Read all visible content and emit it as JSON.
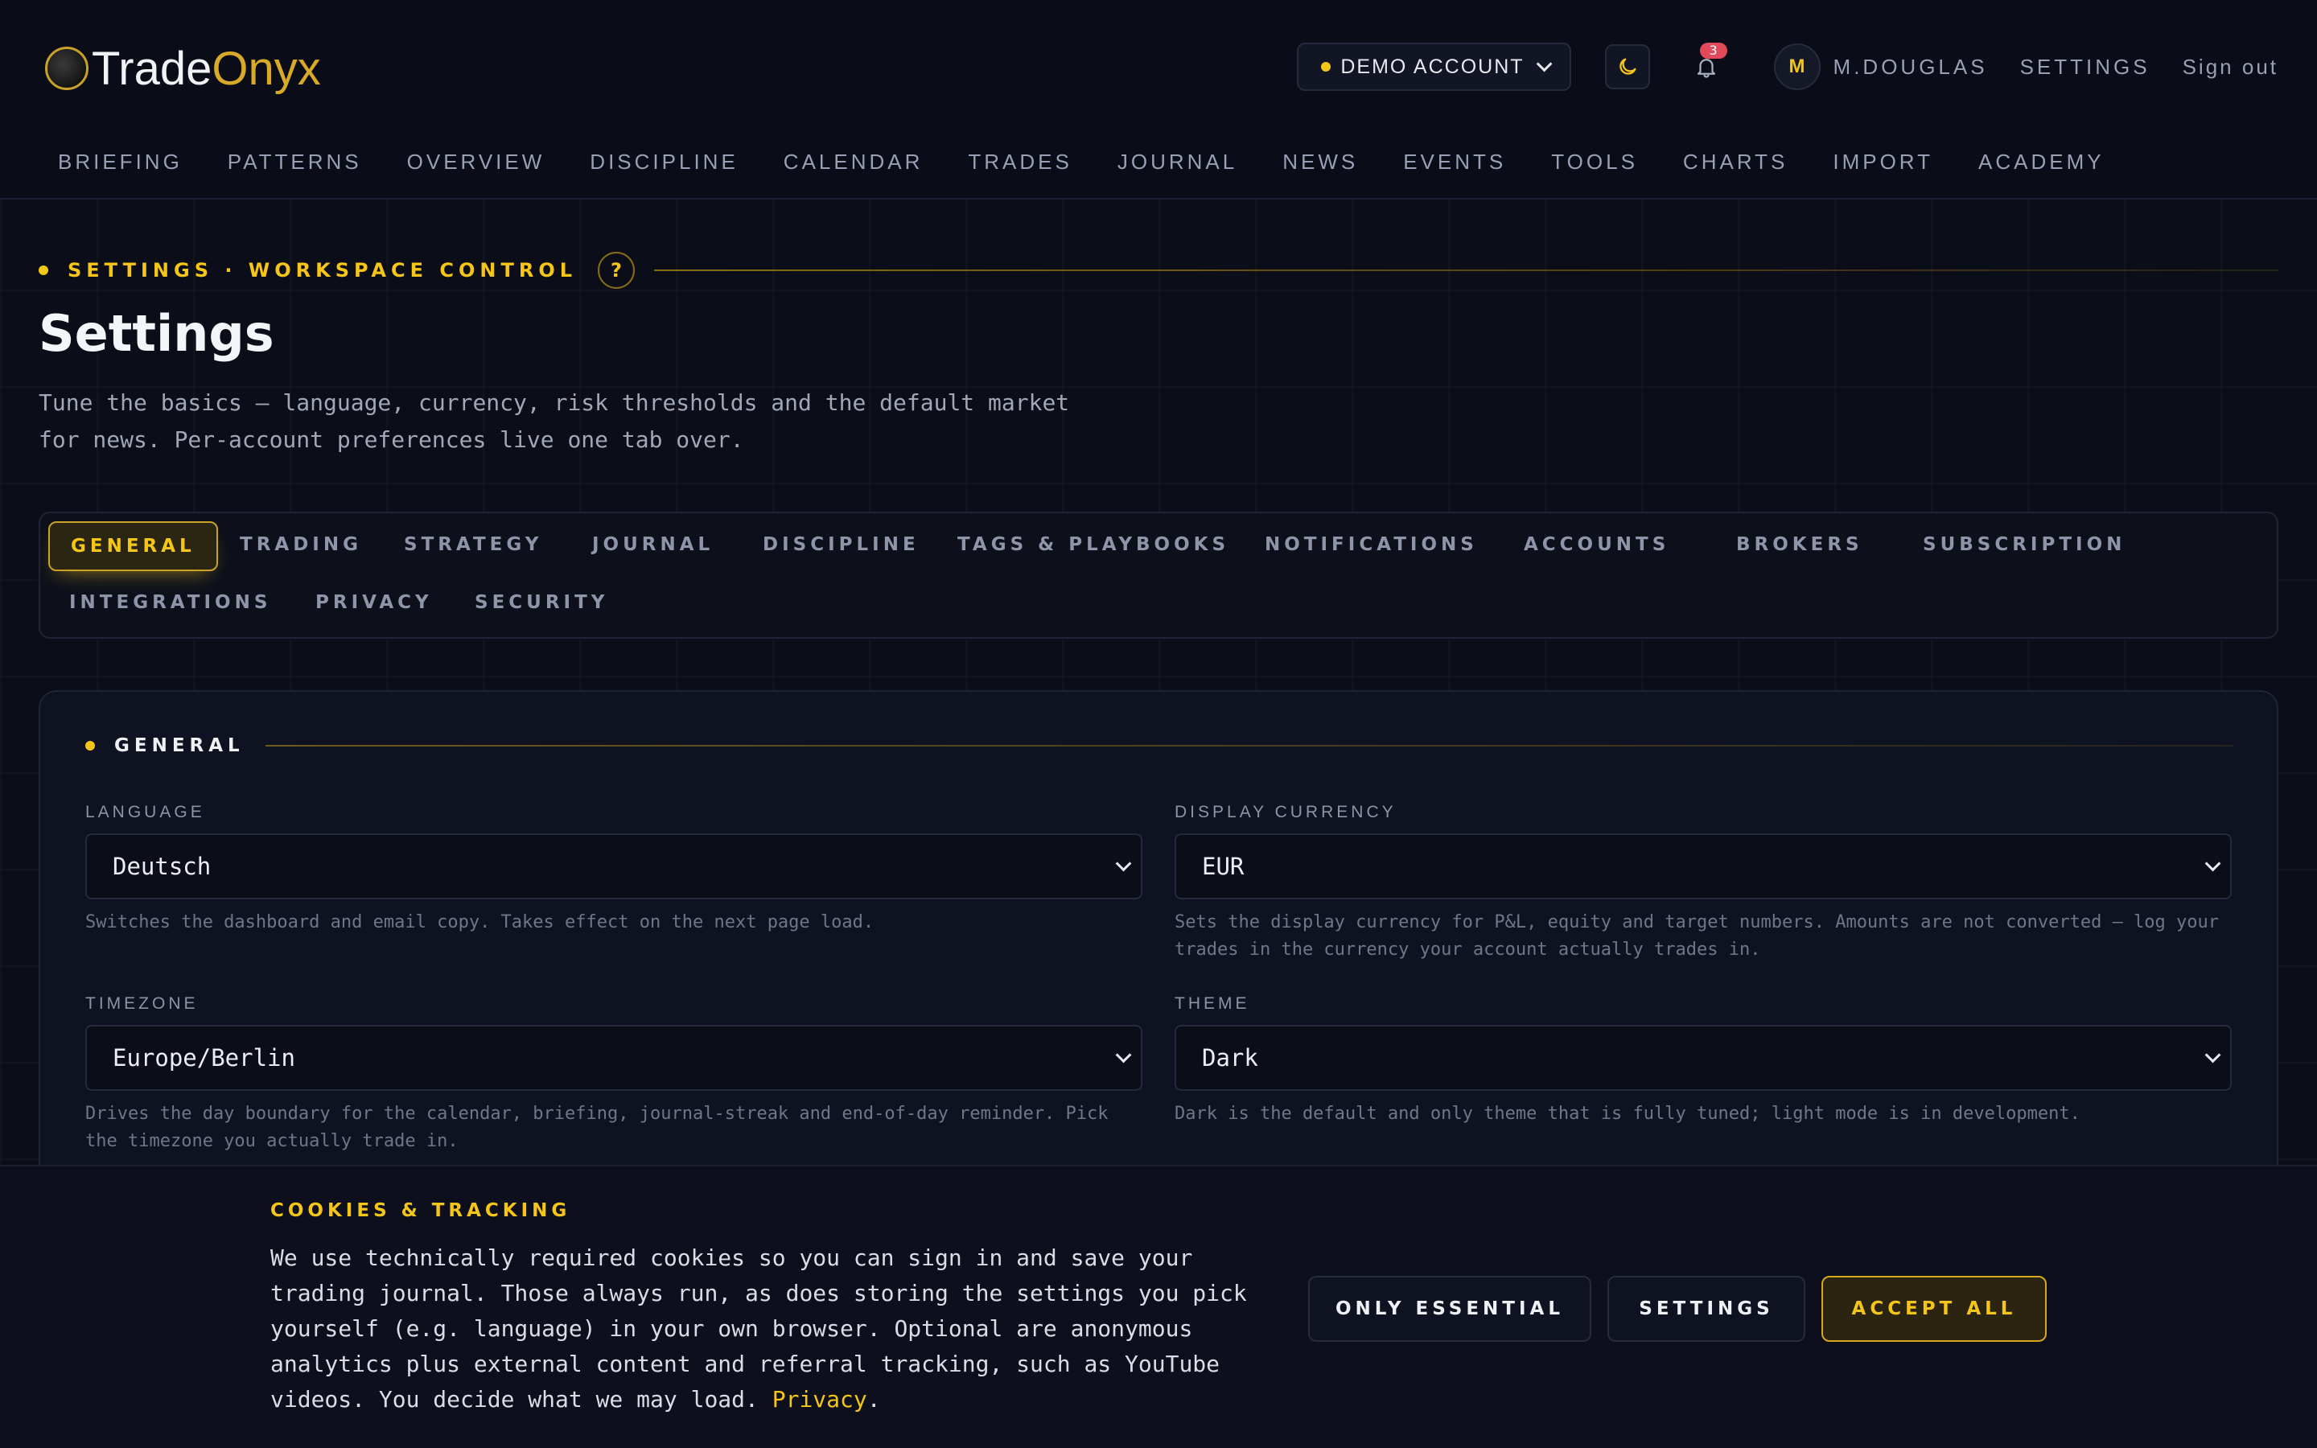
{
  "brand": {
    "name_part1": "Trade",
    "name_part2": "Onyx"
  },
  "header": {
    "account_pill": "DEMO ACCOUNT",
    "notification_count": "3",
    "avatar_initial": "M",
    "username": "M.DOUGLAS",
    "settings_link": "SETTINGS",
    "signout_link": "Sign out"
  },
  "nav": [
    "BRIEFING",
    "PATTERNS",
    "OVERVIEW",
    "DISCIPLINE",
    "CALENDAR",
    "TRADES",
    "JOURNAL",
    "NEWS",
    "EVENTS",
    "TOOLS",
    "CHARTS",
    "IMPORT",
    "ACADEMY"
  ],
  "hero": {
    "eyebrow": "SETTINGS · WORKSPACE CONTROL",
    "help": "?",
    "title": "Settings",
    "description": "Tune the basics — language, currency, risk thresholds and the default market for news. Per-account preferences live one tab over."
  },
  "tabs": [
    "GENERAL",
    "TRADING",
    "STRATEGY",
    "JOURNAL",
    "DISCIPLINE",
    "TAGS & PLAYBOOKS",
    "NOTIFICATIONS",
    "ACCOUNTS",
    "BROKERS",
    "SUBSCRIPTION",
    "INTEGRATIONS",
    "PRIVACY",
    "SECURITY"
  ],
  "active_tab": "GENERAL",
  "general": {
    "section_title": "GENERAL",
    "language": {
      "label": "LANGUAGE",
      "value": "Deutsch",
      "hint": "Switches the dashboard and email copy. Takes effect on the next page load."
    },
    "currency": {
      "label": "DISPLAY CURRENCY",
      "value": "EUR",
      "hint": "Sets the display currency for P&L, equity and target numbers. Amounts are not converted — log your trades in the currency your account actually trades in."
    },
    "timezone": {
      "label": "TIMEZONE",
      "value": "Europe/Berlin",
      "hint": "Drives the day boundary for the calendar, briefing, journal-streak and end-of-day reminder. Pick the timezone you actually trade in."
    },
    "theme": {
      "label": "THEME",
      "value": "Dark",
      "hint": "Dark is the default and only theme that is fully tuned; light mode is in development."
    }
  },
  "cookie": {
    "title": "COOKIES & TRACKING",
    "text": "We use technically required cookies so you can sign in and save your trading journal. Those always run, as does storing the settings you pick yourself (e.g. language) in your own browser. Optional are anonymous analytics plus external content and referral tracking, such as YouTube videos. You decide what we may load.",
    "privacy_link": "Privacy",
    "period": ".",
    "btn_essential": "ONLY ESSENTIAL",
    "btn_settings": "SETTINGS",
    "btn_accept": "ACCEPT ALL"
  },
  "colors": {
    "accent": "#f5c518",
    "background": "#0b0e18",
    "badge": "#e24a5c"
  },
  "icons": [
    "logo-mark-icon",
    "chevron-down-icon",
    "moon-icon",
    "bell-icon",
    "help-icon"
  ]
}
